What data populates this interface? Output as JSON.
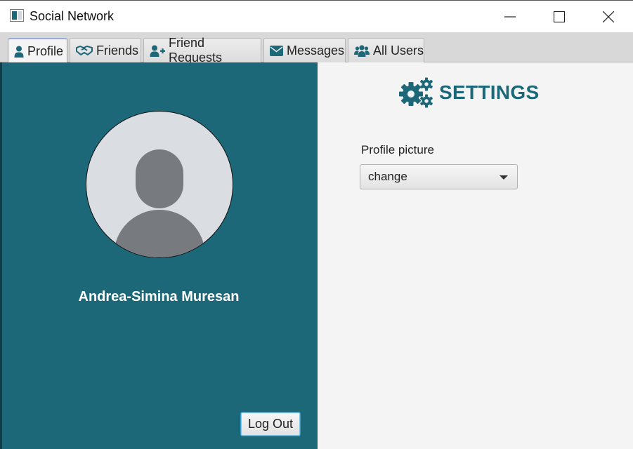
{
  "window": {
    "title": "Social Network"
  },
  "tabs": [
    {
      "label": "Profile",
      "icon": "user-icon",
      "active": true
    },
    {
      "label": "Friends",
      "icon": "handshake-icon",
      "active": false
    },
    {
      "label": "Friend Requests",
      "icon": "user-plus-icon",
      "active": false
    },
    {
      "label": "Messages",
      "icon": "envelope-icon",
      "active": false
    },
    {
      "label": "All Users",
      "icon": "users-icon",
      "active": false
    }
  ],
  "profile": {
    "name": "Andrea-Simina Muresan",
    "logout_label": "Log Out",
    "avatar_icon": "default-avatar-icon"
  },
  "settings": {
    "title": "SETTINGS",
    "icon": "gears-icon",
    "profile_picture_label": "Profile picture",
    "profile_picture_value": "change"
  },
  "colors": {
    "accent": "#1c6879",
    "panel_bg": "#f4f4f4",
    "avatar_bg": "#dadde2",
    "avatar_fg": "#777b80"
  }
}
